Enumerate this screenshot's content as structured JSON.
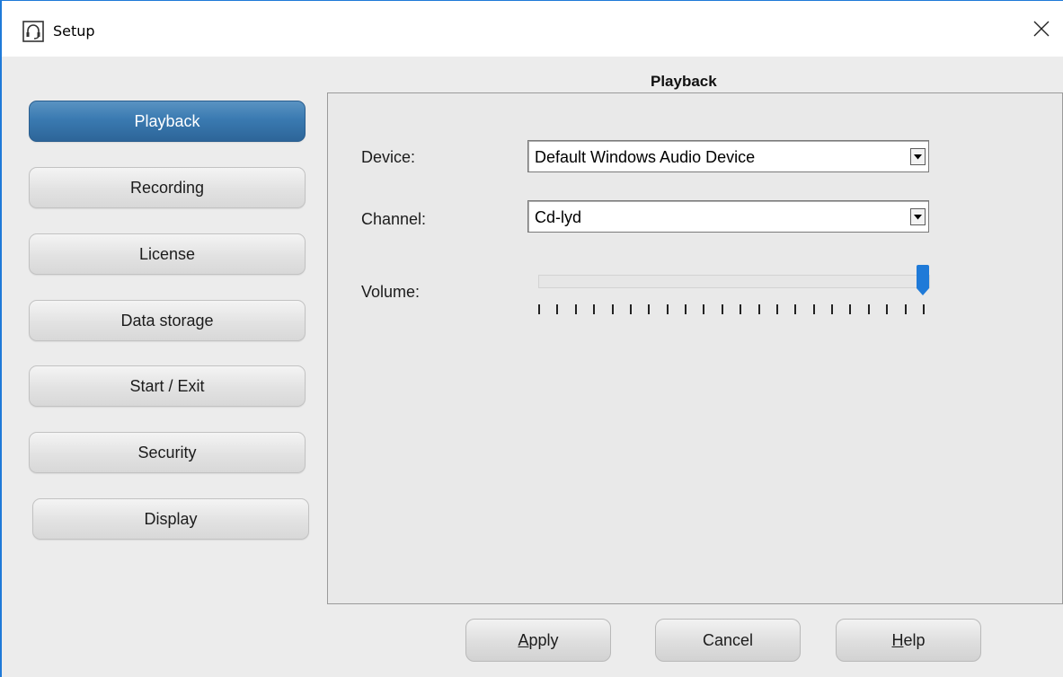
{
  "window": {
    "title": "Setup",
    "icons": {
      "app": "headset-icon",
      "close": "close-icon"
    },
    "accent_color": "#1f7ad8"
  },
  "sidebar": {
    "items": [
      {
        "label": "Playback",
        "active": true
      },
      {
        "label": "Recording",
        "active": false
      },
      {
        "label": "License",
        "active": false
      },
      {
        "label": "Data storage",
        "active": false
      },
      {
        "label": "Start / Exit",
        "active": false
      },
      {
        "label": "Security",
        "active": false
      },
      {
        "label": "Display",
        "active": false
      }
    ],
    "active_color": "#3a7ab1"
  },
  "panel": {
    "title": "Playback",
    "device": {
      "label": "Device:",
      "value": "Default Windows Audio Device"
    },
    "channel": {
      "label": "Channel:",
      "value": "Cd-lyd"
    },
    "volume": {
      "label": "Volume:",
      "level": 1.0,
      "tick_count": 22,
      "thumb_color": "#1f7ad8"
    }
  },
  "footer": {
    "apply": {
      "prefix": "",
      "mnemonic": "A",
      "rest": "pply"
    },
    "cancel": {
      "label": "Cancel"
    },
    "help": {
      "prefix": "",
      "mnemonic": "H",
      "rest": "elp"
    }
  }
}
